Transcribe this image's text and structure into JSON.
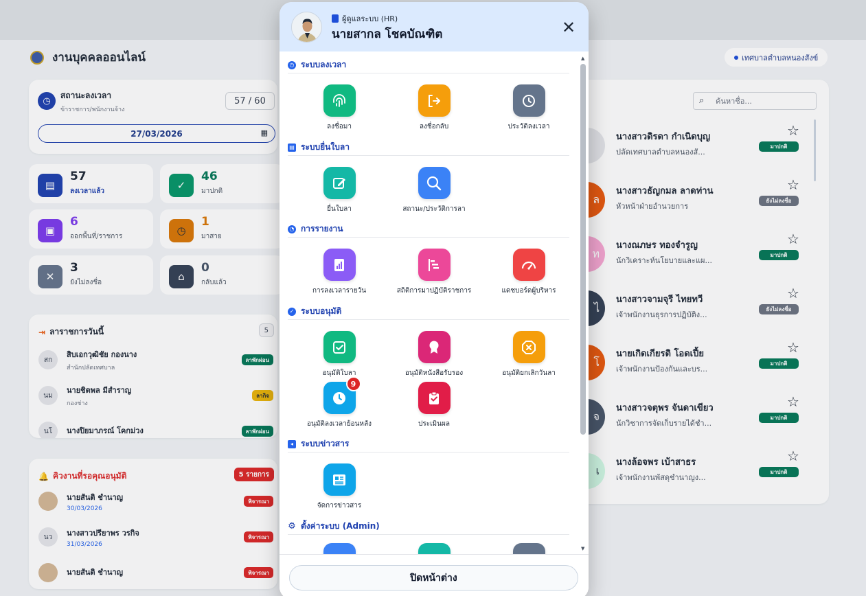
{
  "app": {
    "title": "งานบุคคลออนไลน์",
    "org": "เทศบาลตำบลหนองสังข์"
  },
  "status_card": {
    "title": "สถานะลงเวลา",
    "subtitle": "ข้าราชการ/พนักงานจ้าง",
    "count": "57 / 60",
    "date": "27/03/2026"
  },
  "stats": [
    {
      "value": "57",
      "label": "ลงเวลาแล้ว",
      "color": "#1e40af"
    },
    {
      "value": "46",
      "label": "มาปกติ",
      "color": "#059669"
    },
    {
      "value": "6",
      "label": "ออกพื้นที่/ราชการ",
      "color": "#7c3aed"
    },
    {
      "value": "1",
      "label": "มาสาย",
      "color": "#d97706"
    },
    {
      "value": "3",
      "label": "ยังไม่ลงชื่อ",
      "color": "#64748b"
    },
    {
      "value": "0",
      "label": "กลับแล้ว",
      "color": "#334155"
    }
  ],
  "leave_today": {
    "title": "ลาราชการวันนี้",
    "count": "5",
    "rows": [
      {
        "initials": "สก",
        "name": "สิบเอกวุฒิชัย กองนาง",
        "sub": "สำนักปลัดเทศบาล",
        "tag": "ลาพักผ่อน",
        "tag_color": "#047857"
      },
      {
        "initials": "นม",
        "name": "นายชิตพล มีสำราญ",
        "sub": "กองช่าง",
        "tag": "ลากิจ",
        "tag_color": "#ca8a04"
      },
      {
        "initials": "นโ",
        "name": "นางปิยมาภรณ์ โคกม่วง",
        "sub": "",
        "tag": "ลาพักผ่อน",
        "tag_color": "#047857"
      }
    ]
  },
  "approval_queue": {
    "title": "คิวงานที่รอคุณอนุมัติ",
    "count": "5 รายการ",
    "rows": [
      {
        "initials": "",
        "name": "นายสันติ ชำนาญ",
        "sub": "30/03/2026",
        "tag": "พิจารณา"
      },
      {
        "initials": "นว",
        "name": "นางสาวปรียาพร วรกิจ",
        "sub": "31/03/2026",
        "tag": "พิจารณา"
      },
      {
        "initials": "",
        "name": "นายสันติ ชำนาญ",
        "sub": "",
        "tag": "พิจารณา"
      }
    ]
  },
  "people": {
    "search_placeholder": "ค้นหาชื่อ...",
    "list": [
      {
        "initials": "",
        "name": "นางสาวดิรดา กำเนิดบุญ",
        "sub": "ปลัดเทศบาลตำบลหนองสั...",
        "tag": "มาปกติ",
        "tag_color": "#047857",
        "av_color": "#e5e7eb"
      },
      {
        "initials": "ล",
        "name": "นางสาวธัญกมล ลาดท่าน",
        "sub": "หัวหน้าฝ่ายอำนวยการ",
        "tag": "ยังไม่ลงชื่อ",
        "tag_color": "#6b7280",
        "av_color": "#ea580c"
      },
      {
        "initials": "ท",
        "name": "นางณภษร ทองจำรูญ",
        "sub": "นักวิเคราะห์นโยบายและแผ...",
        "tag": "มาปกติ",
        "tag_color": "#047857",
        "av_color": "#f9a8d4"
      },
      {
        "initials": "ไ",
        "name": "นางสาวจามจุรี ไทยทวี",
        "sub": "เจ้าพนักงานธุรการปฏิบัติง...",
        "tag": "ยังไม่ลงชื่อ",
        "tag_color": "#6b7280",
        "av_color": "#334155"
      },
      {
        "initials": "โ",
        "name": "นายเกิดเกียรติ โอดเปี้ย",
        "sub": "เจ้าพนักงานป้องกันและบร...",
        "tag": "มาปกติ",
        "tag_color": "#047857",
        "av_color": "#ea580c"
      },
      {
        "initials": "จ",
        "name": "นางสาวจตุพร จันดาเขียว",
        "sub": "นักวิชาการจัดเก็บรายได้ชำ...",
        "tag": "มาปกติ",
        "tag_color": "#047857",
        "av_color": "#475569"
      },
      {
        "initials": "เ",
        "name": "นางล้อจพร เบ้าสาธร",
        "sub": "เจ้าพนักงานพัสดุชำนาญง...",
        "tag": "มาปกติ",
        "tag_color": "#047857",
        "av_color": "#d1fae5"
      }
    ]
  },
  "modal": {
    "role": "ผู้ดูแลระบบ (HR)",
    "user_name": "นายสากล โชคบัณฑิต",
    "sections": [
      {
        "title": "ระบบลงเวลา",
        "items": [
          {
            "label": "ลงชื่อมา",
            "icon": "fingerprint-icon",
            "color": "#10b981"
          },
          {
            "label": "ลงชื่อกลับ",
            "icon": "logout-icon",
            "color": "#f59e0b"
          },
          {
            "label": "ประวัติลงเวลา",
            "icon": "history-clock-icon",
            "color": "#64748b"
          }
        ]
      },
      {
        "title": "ระบบยื่นใบลา",
        "items": [
          {
            "label": "ยื่นใบลา",
            "icon": "edit-icon",
            "color": "#14b8a6"
          },
          {
            "label": "สถานะ/ประวัติการลา",
            "icon": "search-icon",
            "color": "#3b82f6"
          }
        ]
      },
      {
        "title": "การรายงาน",
        "items": [
          {
            "label": "การลงเวลารายวัน",
            "icon": "bar-report-icon",
            "color": "#8b5cf6"
          },
          {
            "label": "สถิติการมาปฏิบัติราชการ",
            "icon": "gantt-icon",
            "color": "#ec4899"
          },
          {
            "label": "แดชบอร์ดผู้บริหาร",
            "icon": "gauge-icon",
            "color": "#ef4444"
          }
        ]
      },
      {
        "title": "ระบบอนุมัติ",
        "items": [
          {
            "label": "อนุมัติใบลา",
            "icon": "check-square-icon",
            "color": "#10b981"
          },
          {
            "label": "อนุมัติหนังสือรับรอง",
            "icon": "award-icon",
            "color": "#db2777"
          },
          {
            "label": "อนุมัติยกเลิกวันลา",
            "icon": "cancel-octagon-icon",
            "color": "#f59e0b"
          },
          {
            "label": "อนุมัติลงเวลาย้อนหลัง",
            "icon": "clock-icon",
            "color": "#0ea5e9",
            "badge": "9"
          },
          {
            "label": "ประเมินผล",
            "icon": "clipboard-check-icon",
            "color": "#e11d48"
          }
        ]
      },
      {
        "title": "ระบบข่าวสาร",
        "items": [
          {
            "label": "จัดการข่าวสาร",
            "icon": "newspaper-icon",
            "color": "#0ea5e9"
          }
        ]
      },
      {
        "title": "ตั้งค่าระบบ (Admin)",
        "items": []
      }
    ],
    "close_label": "ปิดหน้าต่าง"
  }
}
